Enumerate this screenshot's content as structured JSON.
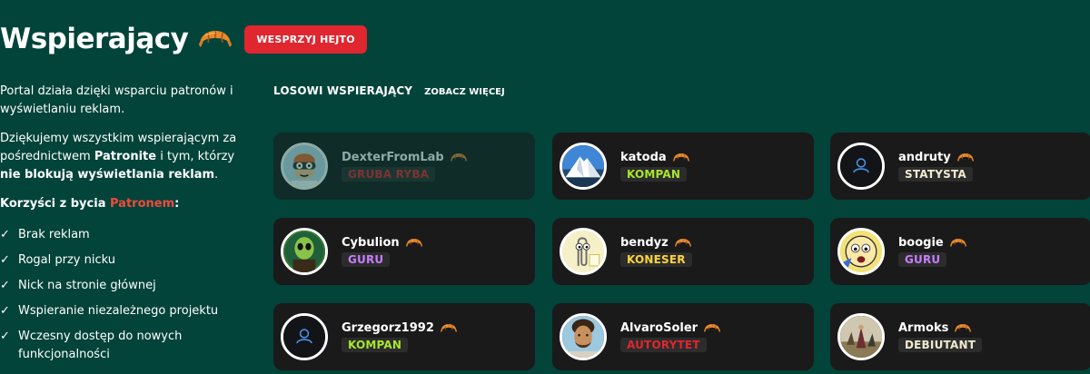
{
  "header": {
    "title": "Wspierający",
    "support_button": "WESPRZYJ HEJTO"
  },
  "intro": {
    "p1": "Portal działa dzięki wsparciu patronów i wyświetlaniu reklam.",
    "p2_a": "Dziękujemy wszystkim wspierającym za pośrednictwem ",
    "p2_b": "Patronite",
    "p2_c": " i tym, którzy ",
    "p2_d": "nie blokują wyświetlania reklam",
    "p2_e": ".",
    "benefits_a": "Korzyści z bycia ",
    "benefits_b": "Patronem",
    "benefits_c": ":",
    "benefits": [
      "Brak reklam",
      "Rogal przy nicku",
      "Nick na stronie głównej",
      "Wspieranie niezależnego projektu",
      "Wczesny dostęp do nowych funkcjonalności"
    ],
    "check": "✓"
  },
  "section": {
    "title": "LOSOWI WSPIERAJĄCY",
    "see_more": "ZOBACZ WIĘCEJ"
  },
  "supporters": [
    {
      "name": "DexterFromLab",
      "rank": "GRUBA RYBA",
      "rank_color": "#e0262f",
      "avatar_icon": "dexter-avatar-icon",
      "dimmed": true
    },
    {
      "name": "katoda",
      "rank": "KOMPAN",
      "rank_color": "#a8e62c",
      "avatar_icon": "mountain-avatar-icon",
      "dimmed": false
    },
    {
      "name": "andruty",
      "rank": "STATYSTA",
      "rank_color": "#f0ead0",
      "avatar_icon": "default-user-avatar-icon",
      "dimmed": false
    },
    {
      "name": "Cybulion",
      "rank": "GURU",
      "rank_color": "#c77dff",
      "avatar_icon": "alien-avatar-icon",
      "dimmed": false
    },
    {
      "name": "bendyz",
      "rank": "KONESER",
      "rank_color": "#ffd23a",
      "avatar_icon": "clippy-avatar-icon",
      "dimmed": false
    },
    {
      "name": "boogie",
      "rank": "GURU",
      "rank_color": "#c77dff",
      "avatar_icon": "cartoon-face-avatar-icon",
      "dimmed": false
    },
    {
      "name": "Grzegorz1992",
      "rank": "KOMPAN",
      "rank_color": "#a8e62c",
      "avatar_icon": "default-user-avatar-icon",
      "dimmed": false
    },
    {
      "name": "AlvaroSoler",
      "rank": "AUTORYTET",
      "rank_color": "#e0262f",
      "avatar_icon": "person-photo-avatar-icon",
      "dimmed": false
    },
    {
      "name": "Armoks",
      "rank": "DEBIUTANT",
      "rank_color": "#f0ead0",
      "avatar_icon": "painting-avatar-icon",
      "dimmed": false
    }
  ]
}
